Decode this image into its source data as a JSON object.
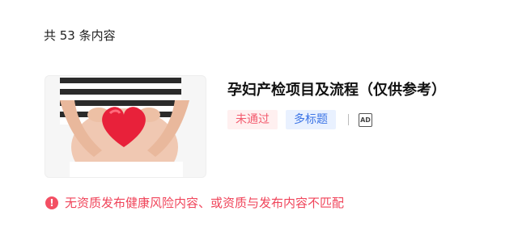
{
  "count_text": "共 53 条内容",
  "card": {
    "title": "孕妇产检项目及流程（仅供参考）",
    "tags": {
      "status": "未通过",
      "type": "多标题"
    },
    "ad_icon_text": "AD",
    "thumbnail_icon": "pregnant-belly-heart-photo"
  },
  "warning": {
    "icon": "exclamation-circle-icon",
    "text": "无资质发布健康风险内容、或资质与发布内容不匹配"
  },
  "colors": {
    "warning_red": "#f0445a",
    "tag_fail_bg": "#fff0f0",
    "tag_multi_bg": "#e9f1ff",
    "tag_multi_text": "#3b74e6"
  }
}
